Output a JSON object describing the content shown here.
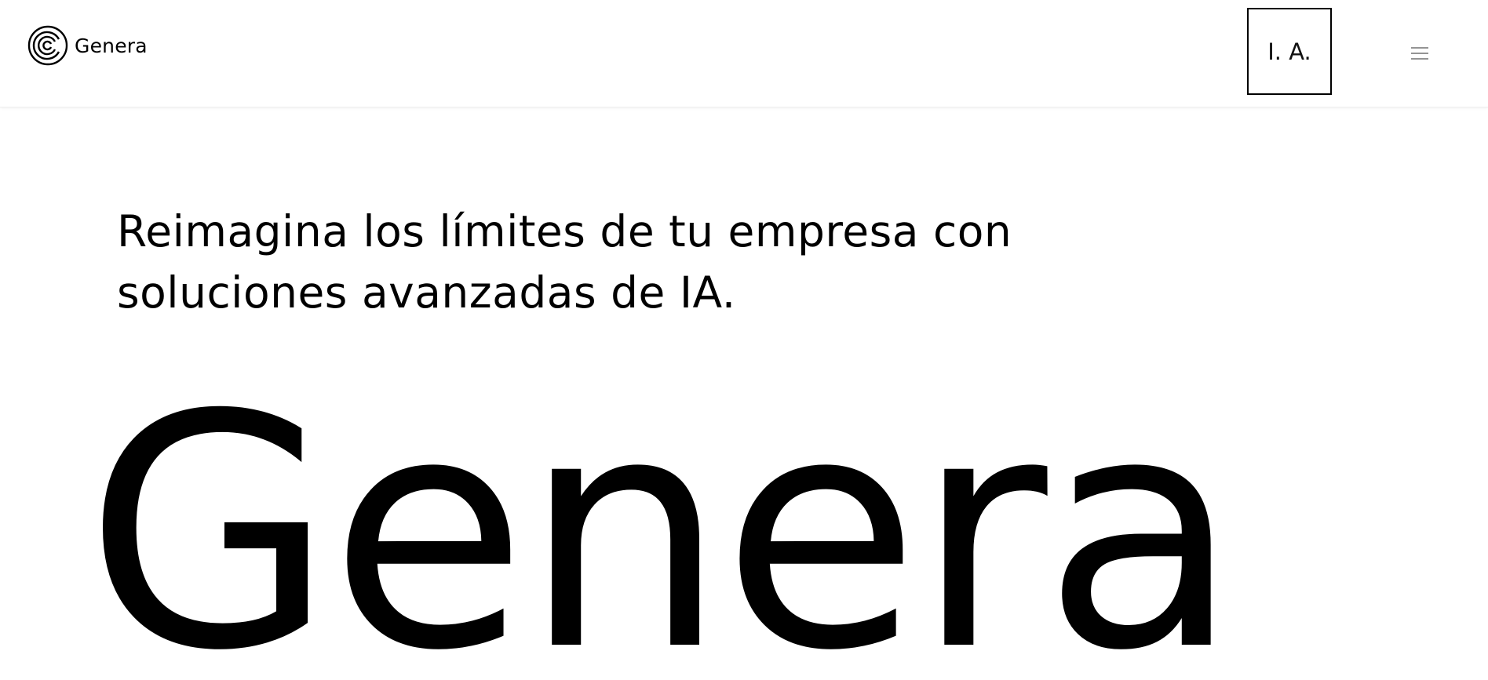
{
  "header": {
    "brand": {
      "name": "Genera",
      "icon": "genera-logo-icon"
    },
    "ia_button_label": "I. A.",
    "menu_icon": "hamburger-menu-icon"
  },
  "hero": {
    "headline_line1": "Reimagina los límites de tu empresa con",
    "headline_line2": "soluciones avanzadas de IA.",
    "wordmark": "Genera"
  },
  "colors": {
    "background": "#ffffff",
    "text": "#000000"
  }
}
